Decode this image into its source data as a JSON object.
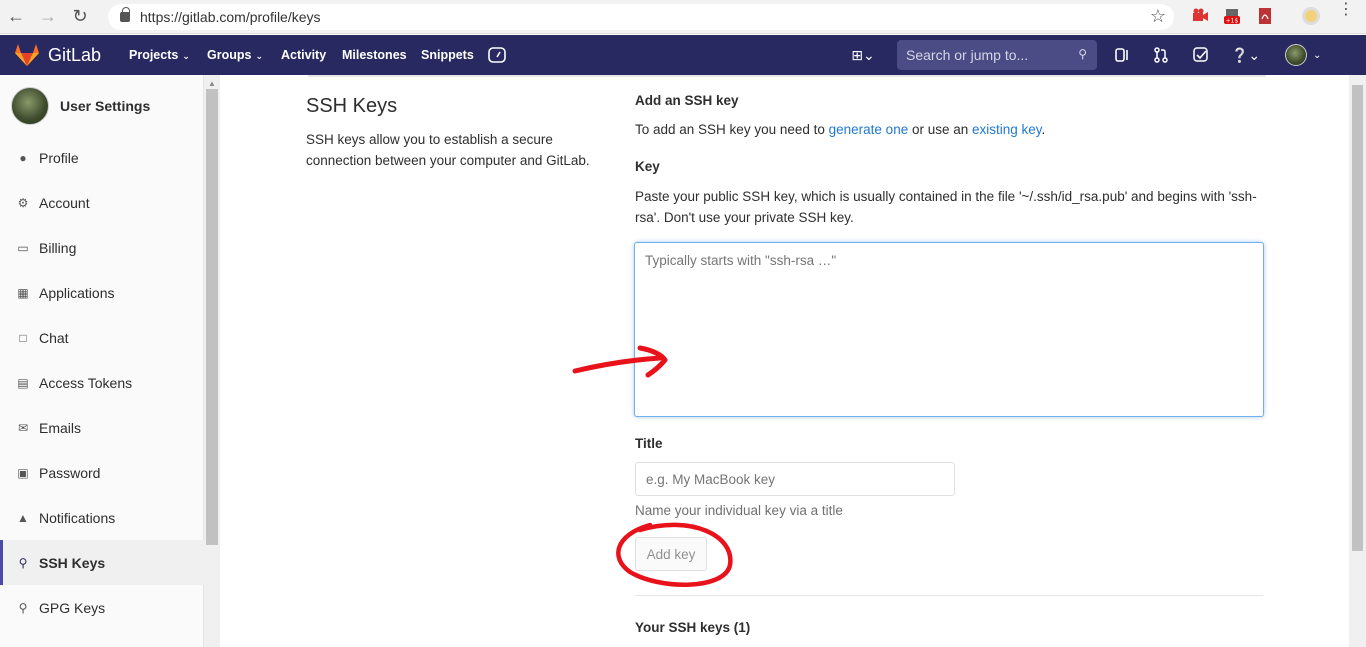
{
  "browser": {
    "url": "https://gitlab.com/profile/keys"
  },
  "topnav": {
    "brand": "GitLab",
    "links": [
      "Projects",
      "Groups",
      "Activity",
      "Milestones",
      "Snippets"
    ],
    "search_placeholder": "Search or jump to..."
  },
  "sidebar": {
    "title": "User Settings",
    "items": [
      {
        "label": "Profile",
        "icon": "person-icon"
      },
      {
        "label": "Account",
        "icon": "account-gear-icon"
      },
      {
        "label": "Billing",
        "icon": "credit-card-icon"
      },
      {
        "label": "Applications",
        "icon": "grid-icon"
      },
      {
        "label": "Chat",
        "icon": "chat-bubble-icon"
      },
      {
        "label": "Access Tokens",
        "icon": "token-icon"
      },
      {
        "label": "Emails",
        "icon": "envelope-icon"
      },
      {
        "label": "Password",
        "icon": "lock-icon"
      },
      {
        "label": "Notifications",
        "icon": "bell-icon"
      },
      {
        "label": "SSH Keys",
        "icon": "key-icon",
        "active": true
      },
      {
        "label": "GPG Keys",
        "icon": "key-icon"
      }
    ]
  },
  "main": {
    "title": "SSH Keys",
    "description": "SSH keys allow you to establish a secure connection between your computer and GitLab.",
    "add_heading": "Add an SSH key",
    "add_text_prefix": "To add an SSH key you need to ",
    "generate_link": "generate one",
    "add_text_mid": " or use an ",
    "existing_link": "existing key",
    "add_text_suffix": ".",
    "key_label": "Key",
    "key_help": "Paste your public SSH key, which is usually contained in the file '~/.ssh/id_rsa.pub' and begins with 'ssh-rsa'. Don't use your private SSH key.",
    "key_placeholder": "Typically starts with \"ssh-rsa …\"",
    "title_label": "Title",
    "title_placeholder": "e.g. My MacBook key",
    "title_help": "Name your individual key via a title",
    "add_button": "Add key",
    "your_keys": "Your SSH keys (1)"
  },
  "colors": {
    "nav_bg": "#292961",
    "link": "#1f78d1",
    "annotation": "#e8131a"
  }
}
